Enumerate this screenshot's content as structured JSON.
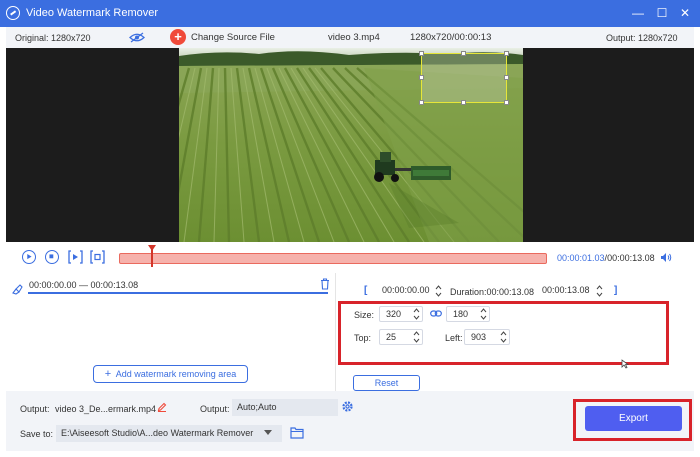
{
  "window": {
    "title": "Video Watermark Remover",
    "controls": {
      "minimize": "—",
      "maximize": "☐",
      "close": "✕"
    }
  },
  "info_bar": {
    "original": "Original: 1280x720",
    "change_source": "Change Source File",
    "file_name": "video 3.mp4",
    "resolution_duration": "1280x720/00:00:13",
    "output": "Output: 1280x720"
  },
  "player": {
    "current_time": "00:00:01.03",
    "separator": "/",
    "total_time": "00:00:13.08",
    "progress": 0.078
  },
  "area_list": {
    "range_text": "00:00:00.00 — 00:00:13.08",
    "add_button": "Add watermark removing area"
  },
  "area_settings": {
    "start_time": "00:00:00.00",
    "duration_label": "Duration:00:00:13.08",
    "end_time": "00:00:13.08",
    "size_label": "Size:",
    "width": "320",
    "height": "180",
    "top_label": "Top:",
    "top": "25",
    "left_label": "Left:",
    "left": "903",
    "reset_button": "Reset"
  },
  "export": {
    "output_label": "Output:",
    "output_file": "video 3_De...ermark.mp4",
    "output_settings_label": "Output:",
    "output_settings": "Auto;Auto",
    "save_to_label": "Save to:",
    "save_path": "E:\\Aiseesoft Studio\\A...deo Watermark Remover",
    "export_button": "Export"
  },
  "colors": {
    "accent": "#3b6ee0",
    "highlight_red": "#d8232a",
    "export_button": "#4f5ef0",
    "timeline": "#f6b2ac"
  }
}
